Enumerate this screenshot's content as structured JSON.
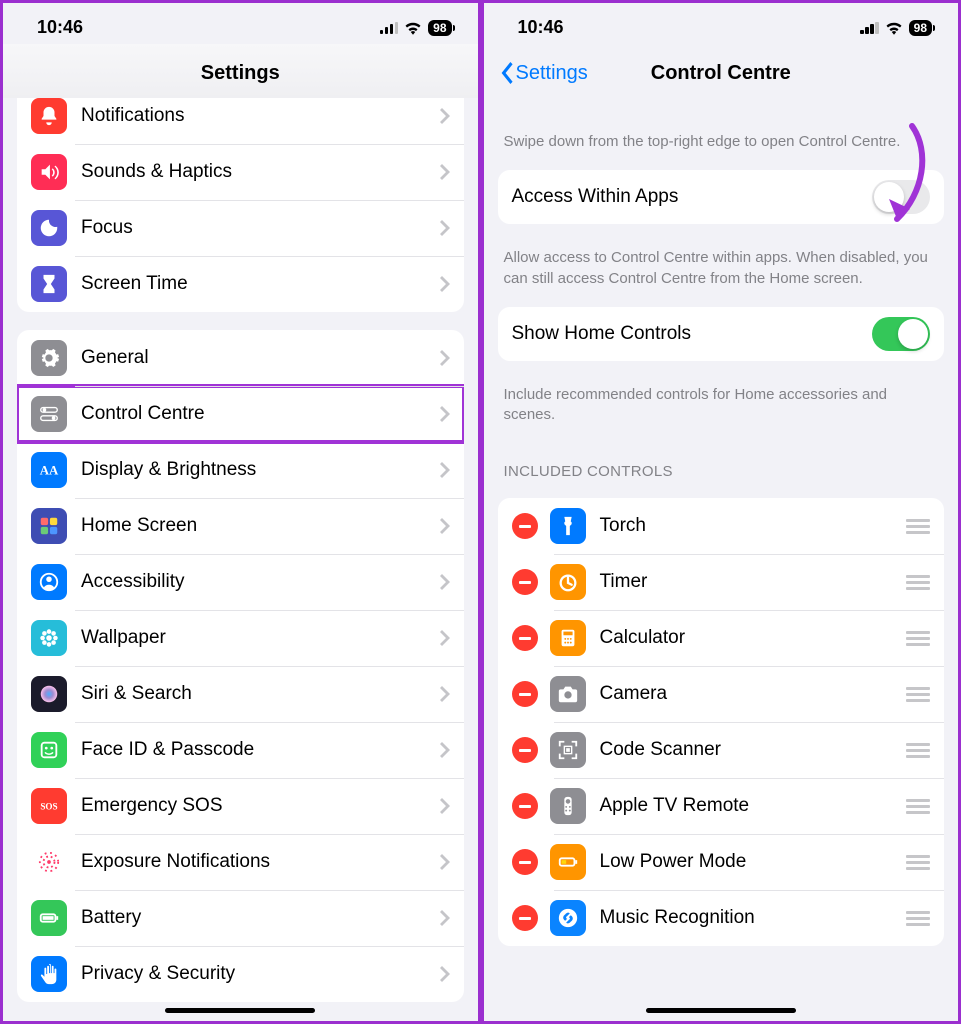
{
  "status": {
    "time": "10:46",
    "battery": "98"
  },
  "left": {
    "title": "Settings",
    "group1": [
      {
        "label": "Notifications",
        "icon": "bell",
        "bg": "#ff3b30",
        "truncated": true
      },
      {
        "label": "Sounds & Haptics",
        "icon": "speaker",
        "bg": "#ff2d55"
      },
      {
        "label": "Focus",
        "icon": "moon",
        "bg": "#5856d6"
      },
      {
        "label": "Screen Time",
        "icon": "hourglass",
        "bg": "#5856d6"
      }
    ],
    "group2": [
      {
        "label": "General",
        "icon": "gear",
        "bg": "#8e8e93"
      },
      {
        "label": "Control Centre",
        "icon": "switches",
        "bg": "#8e8e93",
        "highlight": true
      },
      {
        "label": "Display & Brightness",
        "icon": "aa",
        "bg": "#007aff"
      },
      {
        "label": "Home Screen",
        "icon": "grid",
        "bg": "#3e4db3"
      },
      {
        "label": "Accessibility",
        "icon": "person",
        "bg": "#007aff"
      },
      {
        "label": "Wallpaper",
        "icon": "flower",
        "bg": "#26bdd9"
      },
      {
        "label": "Siri & Search",
        "icon": "siri",
        "bg": "#1b1b2b"
      },
      {
        "label": "Face ID & Passcode",
        "icon": "face",
        "bg": "#30d158"
      },
      {
        "label": "Emergency SOS",
        "icon": "sos",
        "bg": "#ff3b30"
      },
      {
        "label": "Exposure Notifications",
        "icon": "exposure",
        "bg": "#fff"
      },
      {
        "label": "Battery",
        "icon": "battery",
        "bg": "#34c759"
      },
      {
        "label": "Privacy & Security",
        "icon": "hand",
        "bg": "#007aff"
      }
    ]
  },
  "right": {
    "back": "Settings",
    "title": "Control Centre",
    "intro": "Swipe down from the top-right edge to open Control Centre.",
    "accessLabel": "Access Within Apps",
    "accessOn": false,
    "accessFooter": "Allow access to Control Centre within apps. When disabled, you can still access Control Centre from the Home screen.",
    "homeLabel": "Show Home Controls",
    "homeOn": true,
    "homeFooter": "Include recommended controls for Home accessories and scenes.",
    "includedHeader": "Included Controls",
    "controls": [
      {
        "label": "Torch",
        "icon": "torch",
        "bg": "#007aff"
      },
      {
        "label": "Timer",
        "icon": "timer",
        "bg": "#ff9500"
      },
      {
        "label": "Calculator",
        "icon": "calc",
        "bg": "#ff9500"
      },
      {
        "label": "Camera",
        "icon": "camera",
        "bg": "#8e8e93"
      },
      {
        "label": "Code Scanner",
        "icon": "qr",
        "bg": "#8e8e93"
      },
      {
        "label": "Apple TV Remote",
        "icon": "remote",
        "bg": "#8e8e93"
      },
      {
        "label": "Low Power Mode",
        "icon": "lowpower",
        "bg": "#ff9500"
      },
      {
        "label": "Music Recognition",
        "icon": "shazam",
        "bg": "#0a84ff"
      }
    ]
  }
}
